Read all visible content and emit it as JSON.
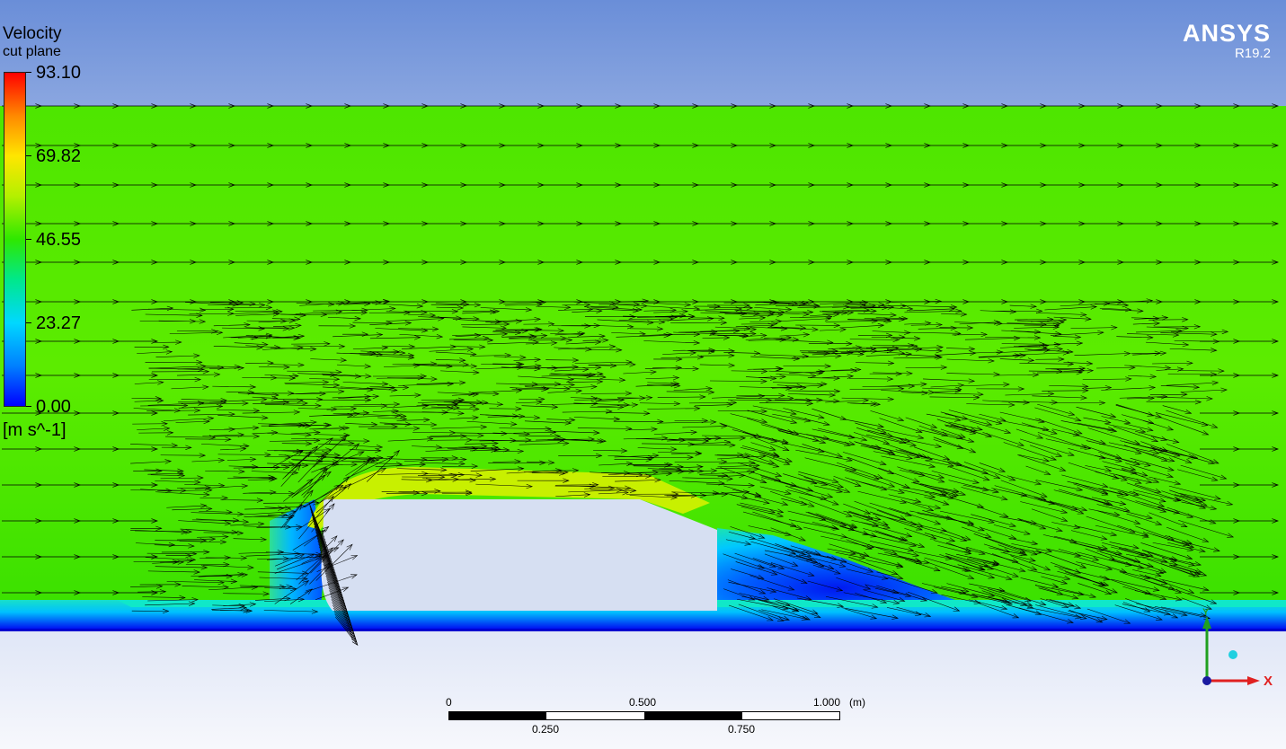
{
  "app": {
    "logo": "ANSYS",
    "version": "R19.2"
  },
  "legend": {
    "title": "Velocity",
    "subtitle": "cut plane",
    "ticks": [
      "93.10",
      "69.82",
      "46.55",
      "23.27",
      "0.00"
    ],
    "units": "[m s^-1]",
    "colormap": [
      "#ff0000",
      "#ff8a00",
      "#ffe600",
      "#2ee800",
      "#00d8ff",
      "#0000ff"
    ]
  },
  "scale": {
    "top_labels": [
      "0",
      "0.500",
      "1.000"
    ],
    "unit": "(m)",
    "bottom_labels": [
      "0.250",
      "0.750"
    ]
  },
  "axes": {
    "x": "X",
    "y": "Y"
  },
  "colors": {
    "flow": "#44e600",
    "ground": "#0000ff",
    "axis_x": "#e02020",
    "axis_y": "#20a020",
    "body": "#d6dff2"
  }
}
